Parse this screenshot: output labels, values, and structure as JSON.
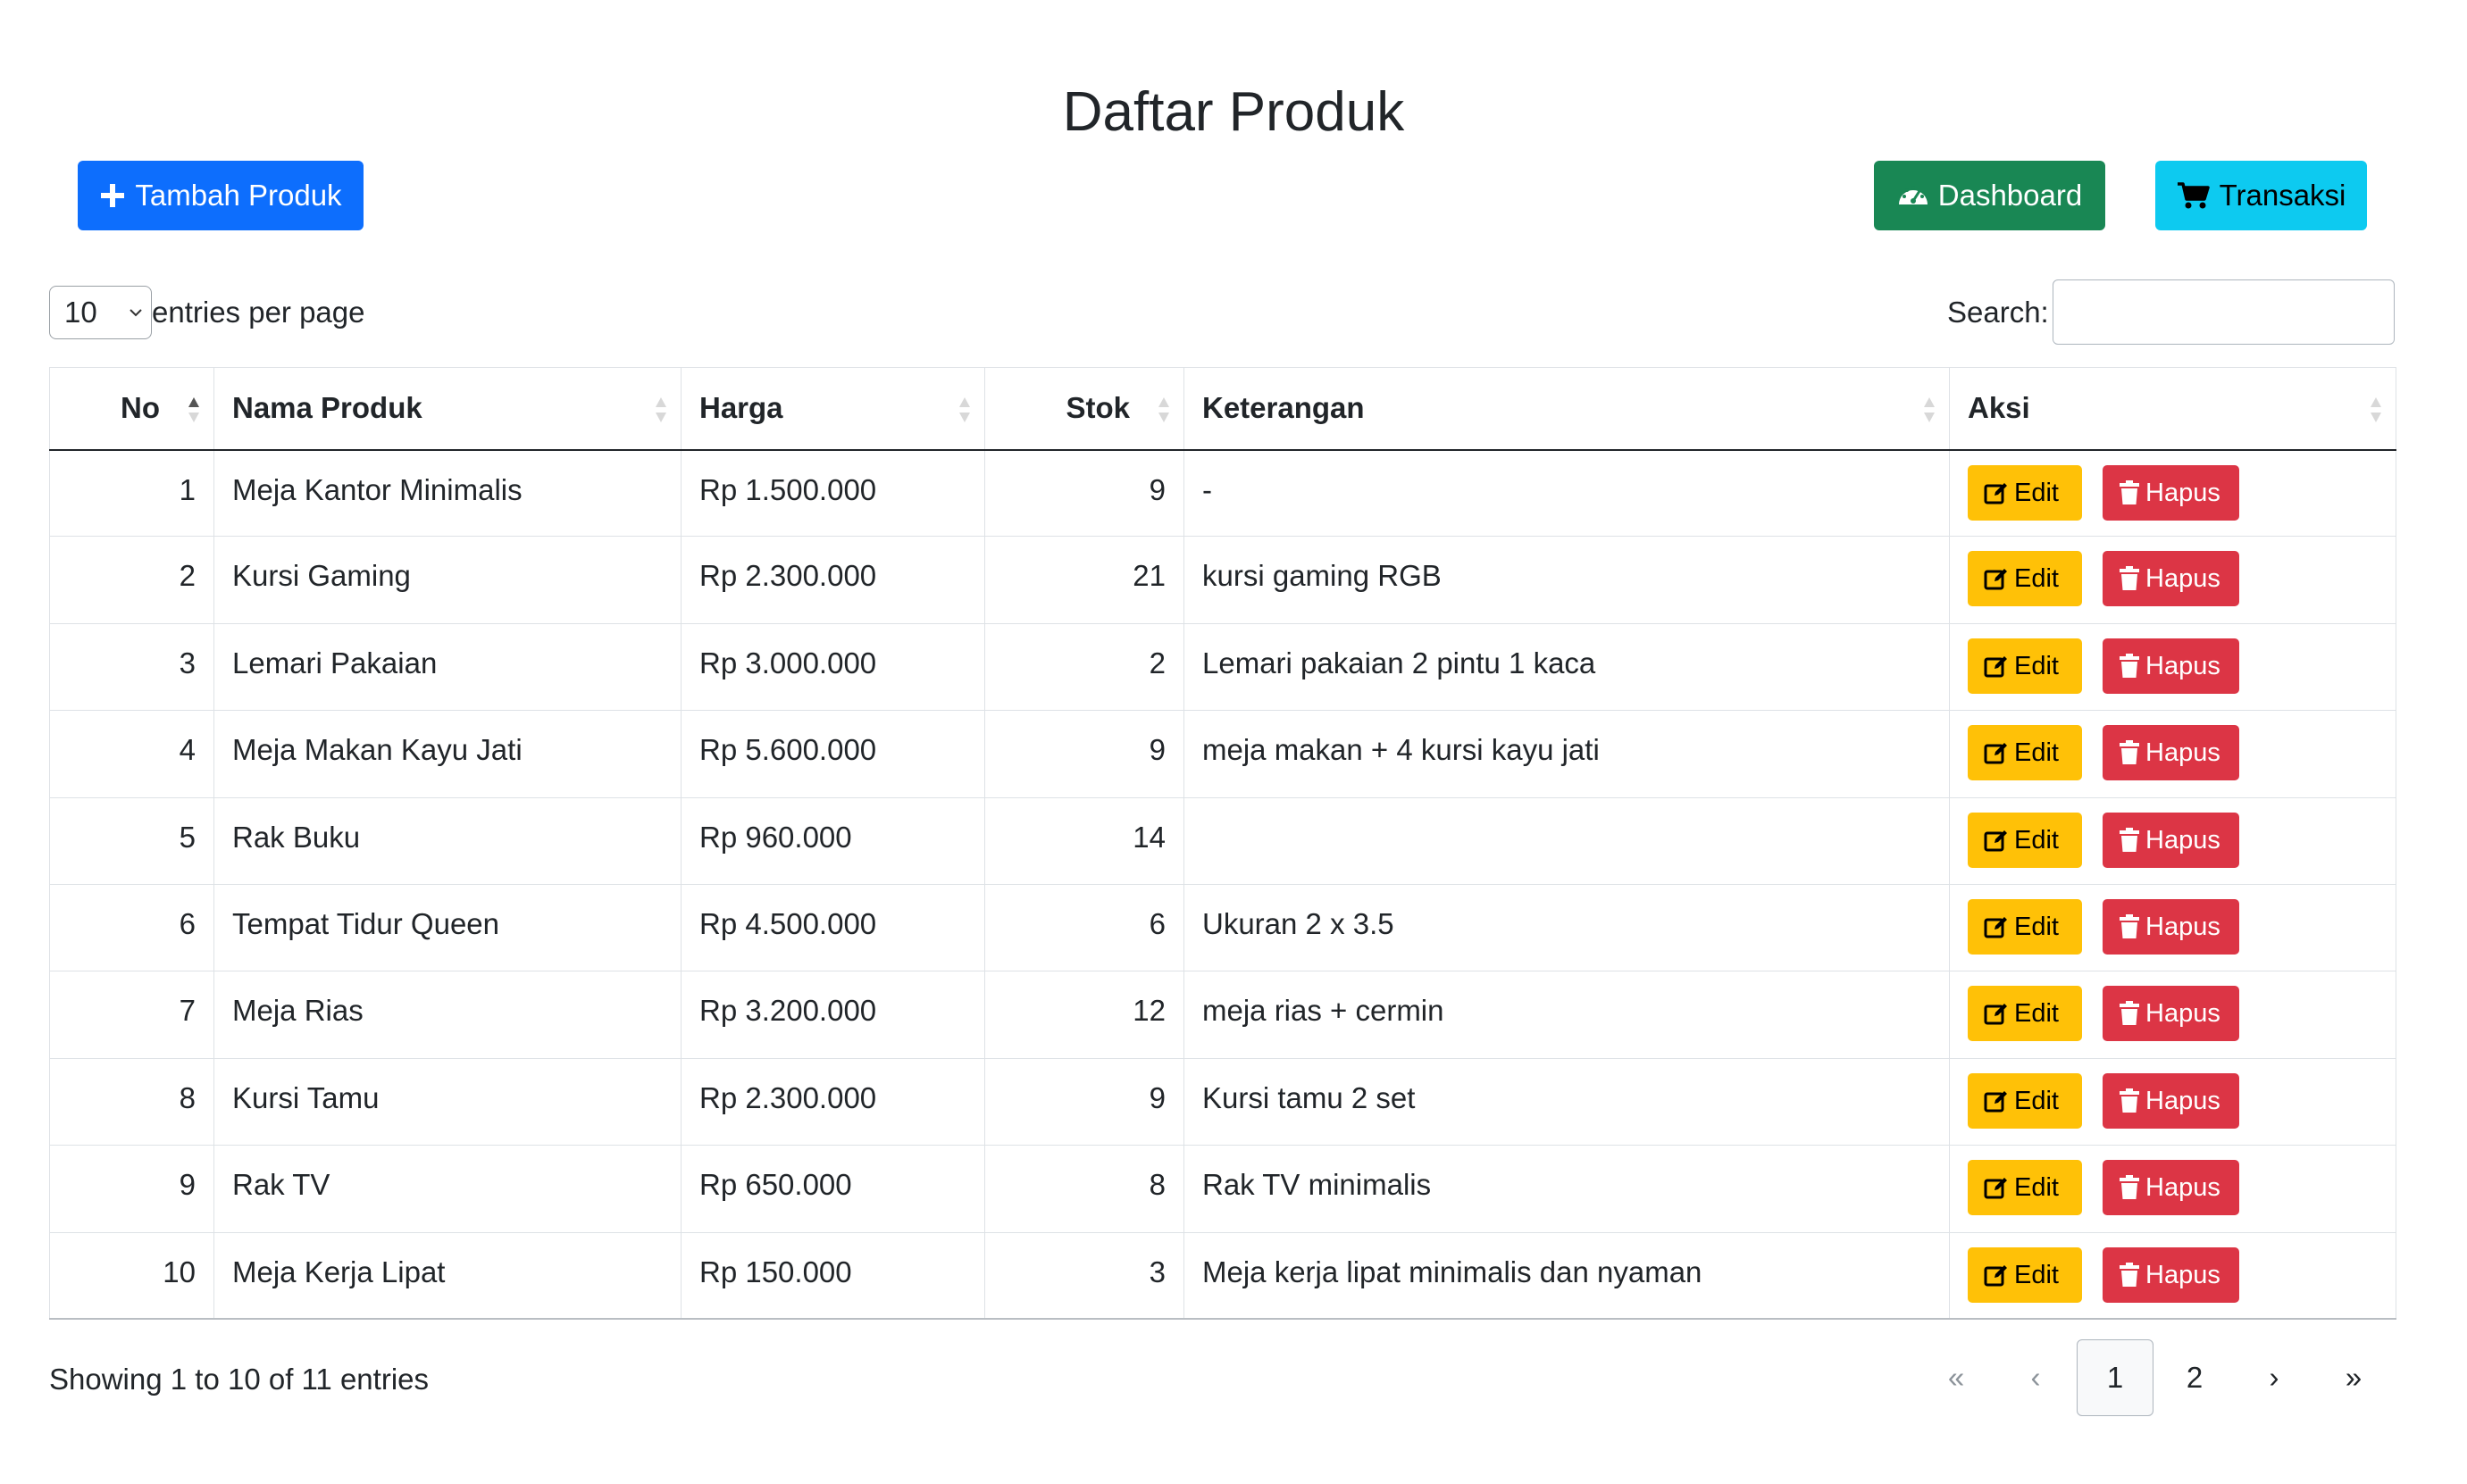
{
  "page": {
    "title": "Daftar Produk"
  },
  "toolbar": {
    "add_label": "Tambah Produk",
    "dashboard_label": "Dashboard",
    "transaksi_label": "Transaksi"
  },
  "controls": {
    "entries_value": "10",
    "entries_label": "entries per page",
    "search_label": "Search:",
    "search_value": ""
  },
  "table": {
    "columns": [
      "No",
      "Nama Produk",
      "Harga",
      "Stok",
      "Keterangan",
      "Aksi"
    ],
    "sort": {
      "column": "No",
      "direction": "asc"
    },
    "rows": [
      {
        "no": "1",
        "nama": "Meja Kantor Minimalis",
        "harga": "Rp 1.500.000",
        "stok": "9",
        "ket": "-"
      },
      {
        "no": "2",
        "nama": "Kursi Gaming",
        "harga": "Rp 2.300.000",
        "stok": "21",
        "ket": "kursi gaming RGB"
      },
      {
        "no": "3",
        "nama": "Lemari Pakaian",
        "harga": "Rp 3.000.000",
        "stok": "2",
        "ket": "Lemari pakaian 2 pintu 1 kaca"
      },
      {
        "no": "4",
        "nama": "Meja Makan Kayu Jati",
        "harga": "Rp 5.600.000",
        "stok": "9",
        "ket": "meja makan + 4 kursi kayu jati"
      },
      {
        "no": "5",
        "nama": "Rak Buku",
        "harga": "Rp 960.000",
        "stok": "14",
        "ket": ""
      },
      {
        "no": "6",
        "nama": "Tempat Tidur Queen",
        "harga": "Rp 4.500.000",
        "stok": "6",
        "ket": "Ukuran 2 x 3.5"
      },
      {
        "no": "7",
        "nama": "Meja Rias",
        "harga": "Rp 3.200.000",
        "stok": "12",
        "ket": "meja rias + cermin"
      },
      {
        "no": "8",
        "nama": "Kursi Tamu",
        "harga": "Rp 2.300.000",
        "stok": "9",
        "ket": "Kursi tamu 2 set"
      },
      {
        "no": "9",
        "nama": "Rak TV",
        "harga": "Rp 650.000",
        "stok": "8",
        "ket": "Rak TV minimalis"
      },
      {
        "no": "10",
        "nama": "Meja Kerja Lipat",
        "harga": "Rp 150.000",
        "stok": "3",
        "ket": "Meja kerja lipat minimalis dan nyaman"
      }
    ],
    "edit_label": "Edit",
    "delete_label": "Hapus"
  },
  "footer": {
    "info": "Showing 1 to 10 of 11 entries",
    "pages": [
      "«",
      "‹",
      "1",
      "2",
      "›",
      "»"
    ],
    "active_page": "1"
  },
  "colors": {
    "primary": "#0d6efd",
    "success": "#198754",
    "info": "#0dcaf0",
    "warning": "#ffc107",
    "danger": "#dc3545"
  },
  "icons": {
    "add": "plus-icon",
    "dashboard": "gauge-icon",
    "transaksi": "cart-icon",
    "edit": "edit-icon",
    "delete": "trash-icon"
  }
}
